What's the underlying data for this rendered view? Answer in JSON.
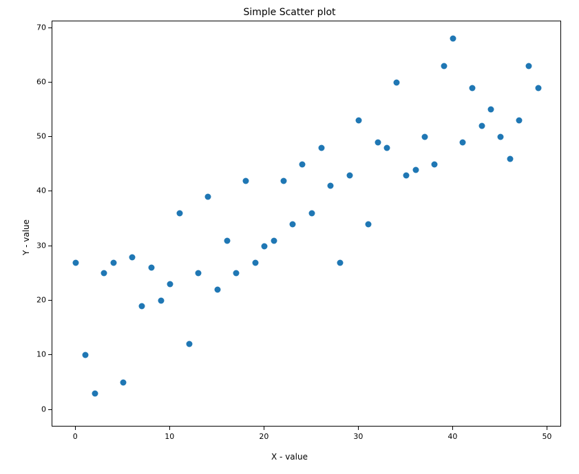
{
  "chart_data": {
    "type": "scatter",
    "title": "Simple Scatter plot",
    "xlabel": "X - value",
    "ylabel": "Y - value",
    "xlim": [
      -2.5,
      51.5
    ],
    "ylim": [
      -3.2,
      71.2
    ],
    "xticks": [
      0,
      10,
      20,
      30,
      40,
      50
    ],
    "yticks": [
      0,
      10,
      20,
      30,
      40,
      50,
      60,
      70
    ],
    "point_color": "#1f77b4",
    "x": [
      0,
      1,
      2,
      3,
      4,
      5,
      6,
      7,
      8,
      9,
      10,
      11,
      12,
      13,
      14,
      15,
      16,
      17,
      18,
      19,
      20,
      21,
      22,
      23,
      24,
      25,
      26,
      27,
      28,
      29,
      30,
      31,
      32,
      33,
      34,
      35,
      36,
      37,
      38,
      39,
      40,
      41,
      42,
      43,
      44,
      45,
      46,
      47,
      48,
      49
    ],
    "y": [
      27,
      10,
      3,
      25,
      27,
      5,
      28,
      19,
      26,
      20,
      23,
      36,
      12,
      25,
      39,
      22,
      31,
      25,
      42,
      27,
      30,
      31,
      42,
      34,
      45,
      36,
      48,
      41,
      27,
      43,
      53,
      34,
      49,
      48,
      60,
      43,
      44,
      50,
      45,
      63,
      68,
      49,
      59,
      52,
      55,
      50,
      46,
      53,
      63,
      59,
      50
    ]
  }
}
